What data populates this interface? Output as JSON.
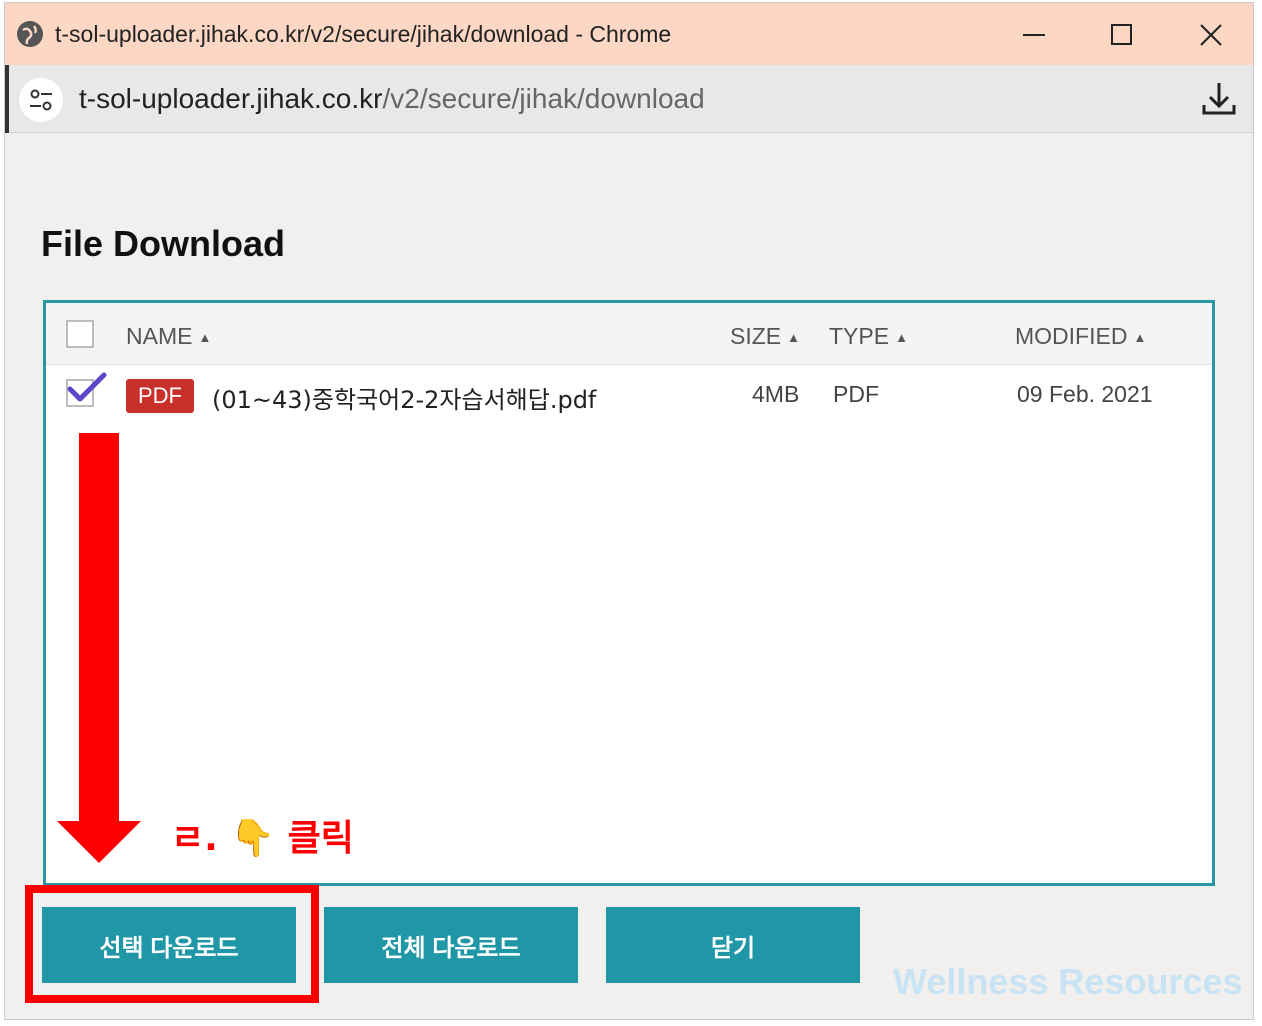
{
  "window": {
    "title": "t-sol-uploader.jihak.co.kr/v2/secure/jihak/download - Chrome"
  },
  "address_bar": {
    "url_host": "t-sol-uploader.jihak.co.kr",
    "url_path": "/v2/secure/jihak/download"
  },
  "page": {
    "title": "File Download"
  },
  "table": {
    "columns": [
      "NAME",
      "SIZE",
      "TYPE",
      "MODIFIED"
    ],
    "sort_arrow": "▲",
    "rows": [
      {
        "checked": true,
        "badge": "PDF",
        "name": "(01~43)중학국어2-2자습서해답.pdf",
        "size": "4MB",
        "type": "PDF",
        "modified": "09 Feb. 2021"
      }
    ]
  },
  "annotation": {
    "label": "ㄹ. 👇 클릭",
    "color": "#ff0000"
  },
  "buttons": {
    "selected_download": "선택 다운로드",
    "all_download": "전체 다운로드",
    "close": "닫기"
  },
  "watermark": "Wellness Resources",
  "colors": {
    "accent": "#1f97a6",
    "panel_border": "#2a97a4",
    "pdf_badge": "#c9302c",
    "titlebar": "#fbd7c4"
  }
}
